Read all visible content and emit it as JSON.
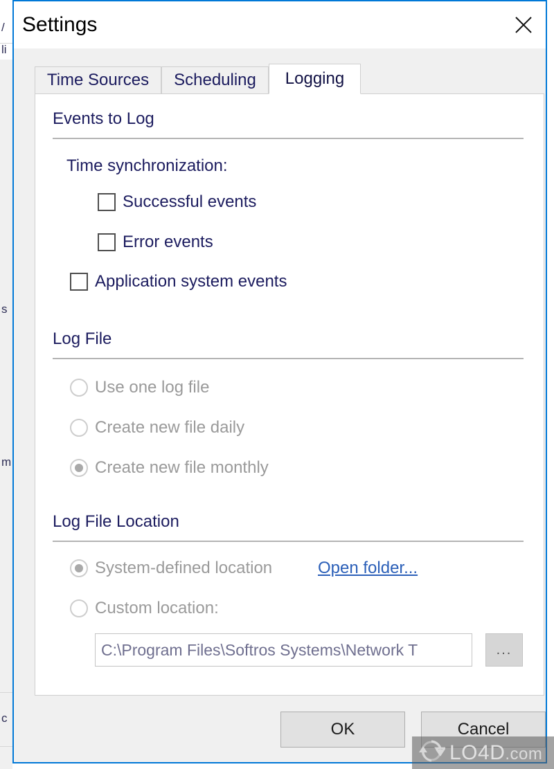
{
  "window": {
    "title": "Settings",
    "close_icon": "close-icon",
    "accent_color": "#0078d7",
    "chrome_color": "#f0f0f0"
  },
  "tabs": [
    {
      "label": "Time Sources",
      "active": false
    },
    {
      "label": "Scheduling",
      "active": false
    },
    {
      "label": "Logging",
      "active": true
    }
  ],
  "panel": {
    "groups": [
      {
        "title": "Events to Log",
        "sub_label": "Time synchronization:",
        "checkboxes": [
          {
            "label": "Successful events",
            "checked": false
          },
          {
            "label": "Error events",
            "checked": false
          },
          {
            "label": "Application system events",
            "checked": false
          }
        ]
      },
      {
        "title": "Log File",
        "radios": [
          {
            "label": "Use one log file",
            "checked": false
          },
          {
            "label": "Create new file daily",
            "checked": false
          },
          {
            "label": "Create new file monthly",
            "checked": true
          }
        ]
      },
      {
        "title": "Log File Location",
        "radios": [
          {
            "label": "System-defined location",
            "checked": true
          },
          {
            "label": "Custom location:",
            "checked": false
          }
        ],
        "link": "Open folder...",
        "path_value": "C:\\Program Files\\Softros Systems\\Network T",
        "browse_label": "..."
      }
    ]
  },
  "footer": {
    "ok_label": "OK",
    "cancel_label": "Cancel"
  },
  "watermark": {
    "text": "LO4D",
    "suffix": ".com",
    "logo_icon": "refresh-arrows-icon"
  },
  "background": {
    "fragments": [
      "/",
      "li",
      "s",
      "m",
      "c"
    ]
  }
}
